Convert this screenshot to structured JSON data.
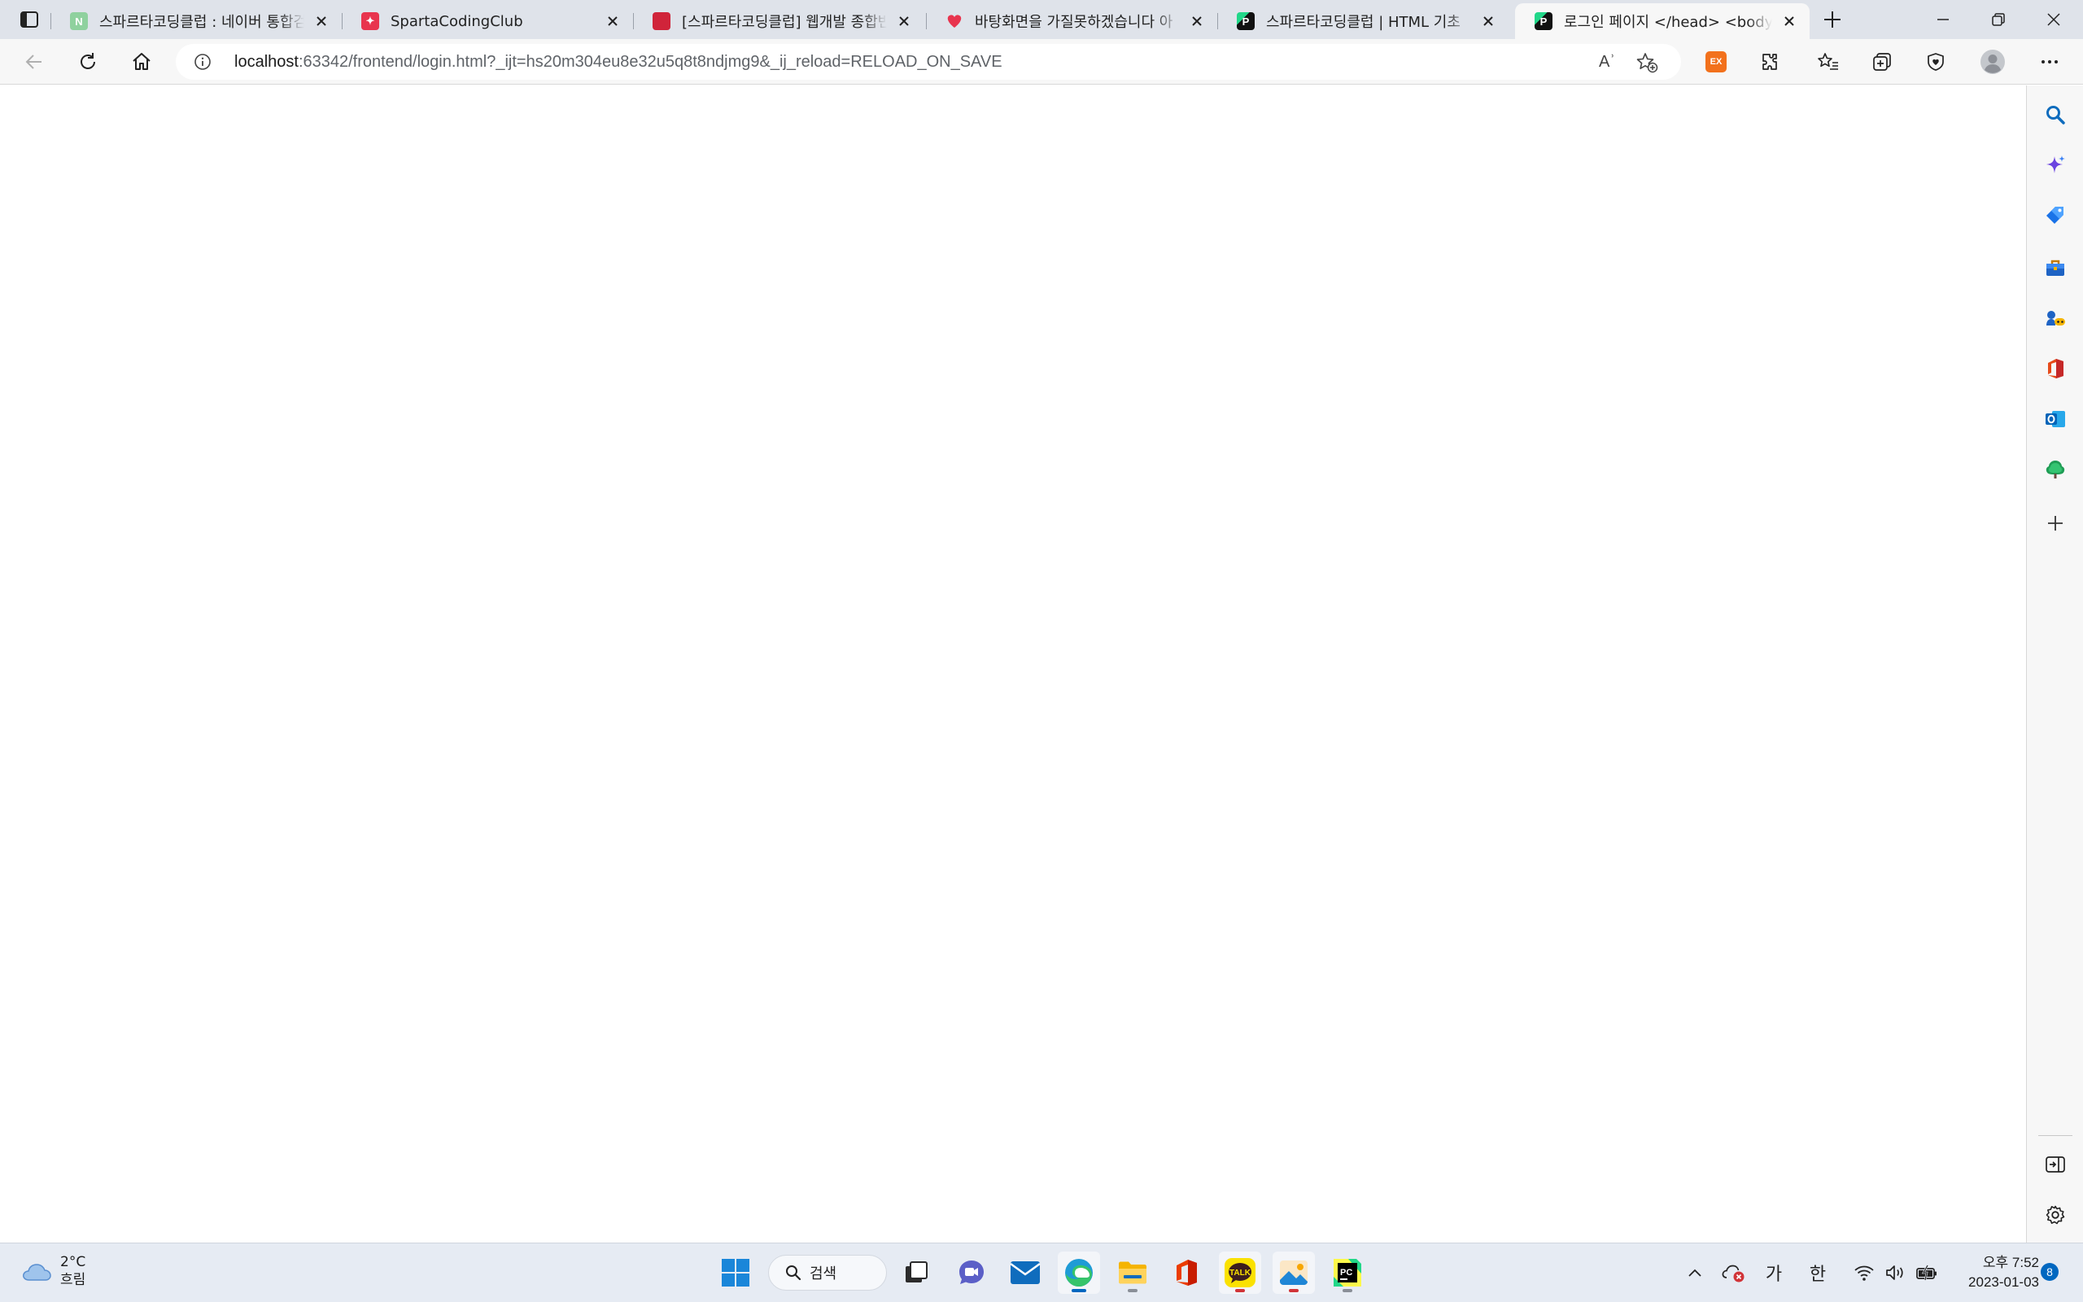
{
  "tabs": [
    {
      "title": "스파르타코딩클럽 : 네이버 통합검색",
      "icon": "naver-icon",
      "color": "#03c75a"
    },
    {
      "title": "SpartaCodingClub",
      "icon": "sparta-icon",
      "color": "#e8344e"
    },
    {
      "title": "[스파르타코딩클럽] 웹개발 종합반",
      "icon": "notebook-icon",
      "color": "#d0243a"
    },
    {
      "title": "바탕화면을 가질못하겠습니다 아",
      "icon": "heart-icon",
      "color": "#e8344e"
    },
    {
      "title": "스파르타코딩클럽 | HTML 기초",
      "icon": "pycharm-icon",
      "color": "#000000"
    },
    {
      "title": "로그인 페이지 </head> <body>",
      "icon": "pycharm-icon",
      "color": "#000000"
    }
  ],
  "address": {
    "host": "localhost",
    "rest": ":63342/frontend/login.html?_ijt=hs20m304eu8e32u5q8t8ndjmg9&_ij_reload=RELOAD_ON_SAVE"
  },
  "toolbar": {
    "extension_badge": "EX",
    "read_aloud": "Aʾ"
  },
  "taskbar": {
    "weather_temp": "2°C",
    "weather_desc": "흐림",
    "search_label": "검색",
    "ime_mode": "가",
    "ime_lang": "한",
    "time": "오후 7:52",
    "date": "2023-01-03",
    "notifications": "8",
    "apps": [
      "windows-start-icon",
      "search",
      "task-view-icon",
      "teams-chat-icon",
      "mail-icon",
      "edge-icon",
      "file-explorer-icon",
      "office-icon",
      "kakaotalk-icon",
      "photos-icon",
      "pycharm-icon"
    ],
    "kakao_label": "TALK",
    "pycharm_label": "PC"
  },
  "colors": {
    "accent": "#0067c0",
    "tabstrip": "#dfe3ea",
    "toolbar": "#f7f7f7"
  }
}
